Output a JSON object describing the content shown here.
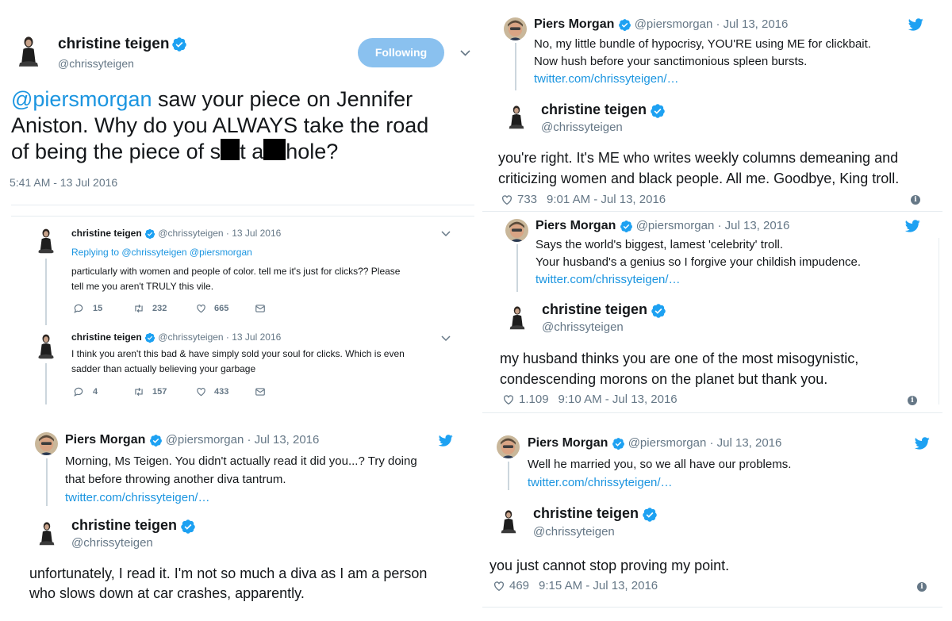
{
  "main_tweet": {
    "name": "christine teigen",
    "handle": "@chrissyteigen",
    "follow_label": "Following",
    "mention": "@piersmorgan",
    "text_line1_rest": " saw your piece on Jennifer",
    "text_line2": "Aniston. Why do you ALWAYS take the road",
    "text_line3_a": "of being the piece of s",
    "text_line3_b": "t a",
    "text_line3_c": "hole?",
    "timestamp": "5:41 AM - 13 Jul 2016"
  },
  "reply1": {
    "name": "christine teigen",
    "handle_date": "@chrissyteigen · 13 Jul 2016",
    "replying_prefix": "Replying to ",
    "replying_to": "@chrissyteigen @piersmorgan",
    "text1": "particularly with women and people of color. tell me it's just for clicks?? Please",
    "text2": "tell me you aren't TRULY this vile.",
    "replies": "15",
    "retweets": "232",
    "likes": "665"
  },
  "reply2": {
    "name": "christine teigen",
    "handle_date": "@chrissyteigen · 13 Jul 2016",
    "text1": "I think you aren't this bad & have simply sold your soul for clicks. Which is even",
    "text2": "sadder than actually believing your garbage",
    "replies": "4",
    "retweets": "157",
    "likes": "433"
  },
  "exchange1": {
    "piers_name": "Piers Morgan",
    "piers_handle_date": "@piersmorgan · Jul 13, 2016",
    "piers_text1": "Morning, Ms Teigen. You didn't actually read it did you...? Try doing",
    "piers_text2": "that before throwing another diva tantrum.",
    "piers_link": "twitter.com/chrissyteigen/…",
    "chrissy_name": "christine teigen",
    "chrissy_handle": "@chrissyteigen",
    "chrissy_text1": "unfortunately, I read it. I'm not so much a diva as I am a person",
    "chrissy_text2": "who slows down at car crashes, apparently."
  },
  "exchange2": {
    "piers_name": "Piers Morgan",
    "piers_handle_date": "@piersmorgan · Jul 13, 2016",
    "piers_text1": "No, my little bundle of hypocrisy, YOU'RE using ME for clickbait.",
    "piers_text2": "Now hush before your sanctimonious spleen bursts.",
    "piers_link": "twitter.com/chrissyteigen/…",
    "chrissy_name": "christine teigen",
    "chrissy_handle": "@chrissyteigen",
    "chrissy_text1": "you're right. It's ME who writes weekly columns demeaning and",
    "chrissy_text2": "criticizing women and black people. All me. Goodbye, King troll.",
    "likes": "733",
    "time": "9:01 AM - Jul 13, 2016"
  },
  "exchange3": {
    "piers_name": "Piers Morgan",
    "piers_handle_date": "@piersmorgan · Jul 13, 2016",
    "piers_text1": "Says the world's biggest, lamest 'celebrity' troll.",
    "piers_text2": "Your husband's a genius so I forgive your childish impudence.",
    "piers_link": "twitter.com/chrissyteigen/…",
    "chrissy_name": "christine teigen",
    "chrissy_handle": "@chrissyteigen",
    "chrissy_text1": "my husband thinks you are one of the most misogynistic,",
    "chrissy_text2": "condescending morons on the planet but thank you.",
    "likes": "1.109",
    "time": "9:10 AM - Jul 13, 2016"
  },
  "exchange4": {
    "piers_name": "Piers Morgan",
    "piers_handle_date": "@piersmorgan · Jul 13, 2016",
    "piers_text1": "Well he married you, so we all have our problems.",
    "piers_link": "twitter.com/chrissyteigen/…",
    "chrissy_name": "christine teigen",
    "chrissy_handle": "@chrissyteigen",
    "chrissy_text1": "you just cannot stop proving my point.",
    "likes": "469",
    "time": "9:15 AM - Jul 13, 2016"
  },
  "colors": {
    "twitter_blue": "#1da1f2",
    "link_blue": "#1b95e0",
    "follow_button": "#8ac1ef",
    "gray_text": "#657786"
  }
}
